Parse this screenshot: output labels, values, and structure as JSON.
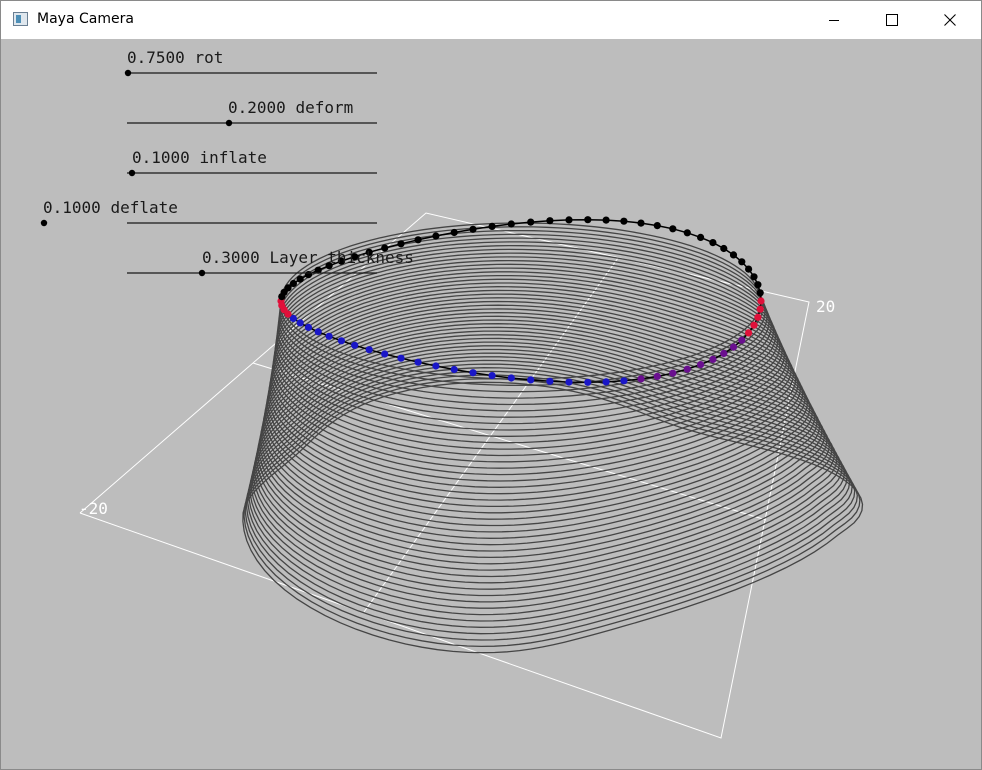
{
  "window": {
    "title": "Maya Camera",
    "controls": [
      "minimize",
      "maximize",
      "close"
    ]
  },
  "sliders": [
    {
      "id": "rot",
      "value_text": "0.7500",
      "label": "rot",
      "value": 0.75
    },
    {
      "id": "deform",
      "value_text": "0.2000",
      "label": "deform",
      "value": 0.2
    },
    {
      "id": "inflate",
      "value_text": "0.1000",
      "label": "inflate",
      "value": 0.1
    },
    {
      "id": "deflate",
      "value_text": "0.1000",
      "label": "deflate",
      "value": 0.1
    },
    {
      "id": "layer-thickness",
      "value_text": "0.3000",
      "label": "Layer thickness",
      "value": 0.3
    }
  ],
  "axes": {
    "right_label": "20",
    "left_label": "-20"
  },
  "colors": {
    "viewport_bg": "#bdbdbd",
    "mesh": "#454545",
    "grid": "#ffffff",
    "vertex_black": "#000000",
    "vertex_blue": "#1a17c8",
    "vertex_purple": "#6a0f8f",
    "vertex_red": "#e0103a"
  }
}
